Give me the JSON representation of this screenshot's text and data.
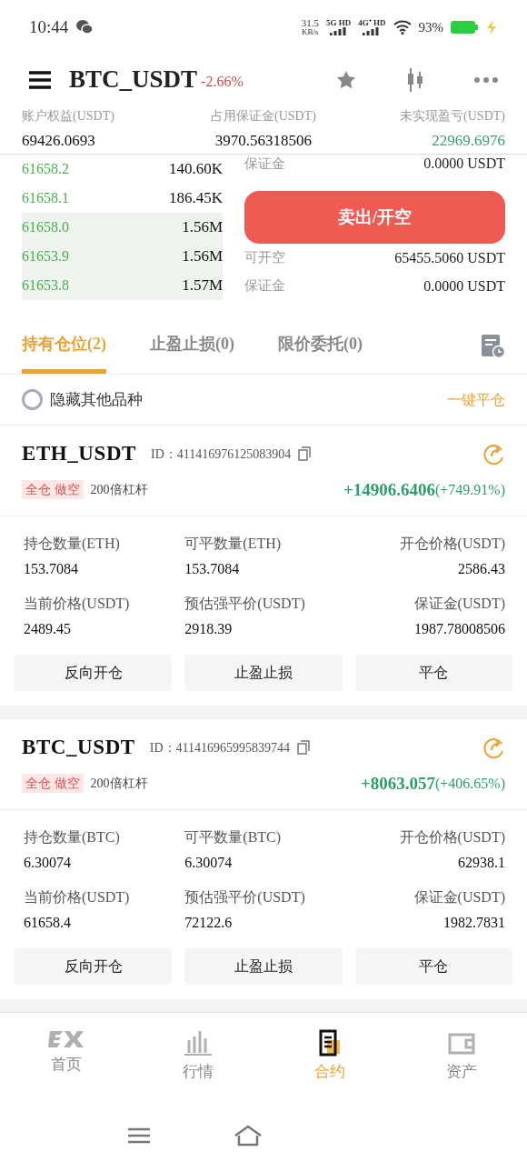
{
  "status_bar": {
    "time": "10:44",
    "speed": "31.5",
    "speed_unit": "KB/s",
    "sim1": "5G HD",
    "sim2": "4G⁺ HD",
    "battery": "93%"
  },
  "header": {
    "symbol": "BTC_USDT",
    "change": "-2.66%"
  },
  "account": [
    {
      "label": "账户权益(USDT)",
      "value": "69426.0693",
      "color": "#111111"
    },
    {
      "label": "占用保证金(USDT)",
      "value": "3970.56318506",
      "color": "#111111"
    },
    {
      "label": "未实现盈亏(USDT)",
      "value": "22969.6976",
      "color": "#3a9e72"
    }
  ],
  "order_book": [
    {
      "price": "61658.2",
      "amount": "140.60K",
      "kind": "none"
    },
    {
      "price": "61658.1",
      "amount": "186.45K",
      "kind": "none"
    },
    {
      "price": "61658.0",
      "amount": "1.56M",
      "kind": "large"
    },
    {
      "price": "61653.9",
      "amount": "1.56M",
      "kind": "large"
    },
    {
      "price": "61653.8",
      "amount": "1.57M",
      "kind": "large"
    }
  ],
  "trade_top": {
    "label": "保证金",
    "value": "0.0000 USDT"
  },
  "sell_button": "卖出/开空",
  "trade_info": [
    {
      "label": "可开空",
      "value": "65455.5060 USDT"
    },
    {
      "label": "保证金",
      "value": "0.0000 USDT"
    }
  ],
  "tabs": [
    {
      "label": "持有仓位(2)",
      "selected": true
    },
    {
      "label": "止盈止损(0)",
      "selected": false
    },
    {
      "label": "限价委托(0)",
      "selected": false
    }
  ],
  "filter": {
    "label": "隐藏其他品种",
    "checked": false,
    "action": "一键平仓"
  },
  "positions": [
    {
      "symbol": "ETH_USDT",
      "id": "ID：411416976125083904",
      "tag": "全仓 做空",
      "leverage": "200倍杠杆",
      "pnl": "+14906.6406",
      "pnl_pct": "(+749.91%)",
      "fields": [
        {
          "label": "持仓数量(ETH)",
          "value": "153.7084"
        },
        {
          "label": "可平数量(ETH)",
          "value": "153.7084"
        },
        {
          "label": "开仓价格(USDT)",
          "value": "2586.43"
        },
        {
          "label": "当前价格(USDT)",
          "value": "2489.45"
        },
        {
          "label": "预估强平价(USDT)",
          "value": "2918.39"
        },
        {
          "label": "保证金(USDT)",
          "value": "1987.78008506"
        }
      ],
      "buttons": [
        "反向开仓",
        "止盈止损",
        "平仓"
      ]
    },
    {
      "symbol": "BTC_USDT",
      "id": "ID：411416965995839744",
      "tag": "全仓 做空",
      "leverage": "200倍杠杆",
      "pnl": "+8063.057",
      "pnl_pct": "(+406.65%)",
      "fields": [
        {
          "label": "持仓数量(BTC)",
          "value": "6.30074"
        },
        {
          "label": "可平数量(BTC)",
          "value": "6.30074"
        },
        {
          "label": "开仓价格(USDT)",
          "value": "62938.1"
        },
        {
          "label": "当前价格(USDT)",
          "value": "61658.4"
        },
        {
          "label": "预估强平价(USDT)",
          "value": "72122.6"
        },
        {
          "label": "保证金(USDT)",
          "value": "1982.7831"
        }
      ],
      "buttons": [
        "反向开仓",
        "止盈止损",
        "平仓"
      ]
    }
  ],
  "bottom_nav": [
    {
      "label": "首页",
      "kind": "home",
      "selected": false
    },
    {
      "label": "行情",
      "kind": "market",
      "selected": false
    },
    {
      "label": "合约",
      "kind": "contract",
      "selected": true
    },
    {
      "label": "资产",
      "kind": "assets",
      "selected": false
    }
  ]
}
